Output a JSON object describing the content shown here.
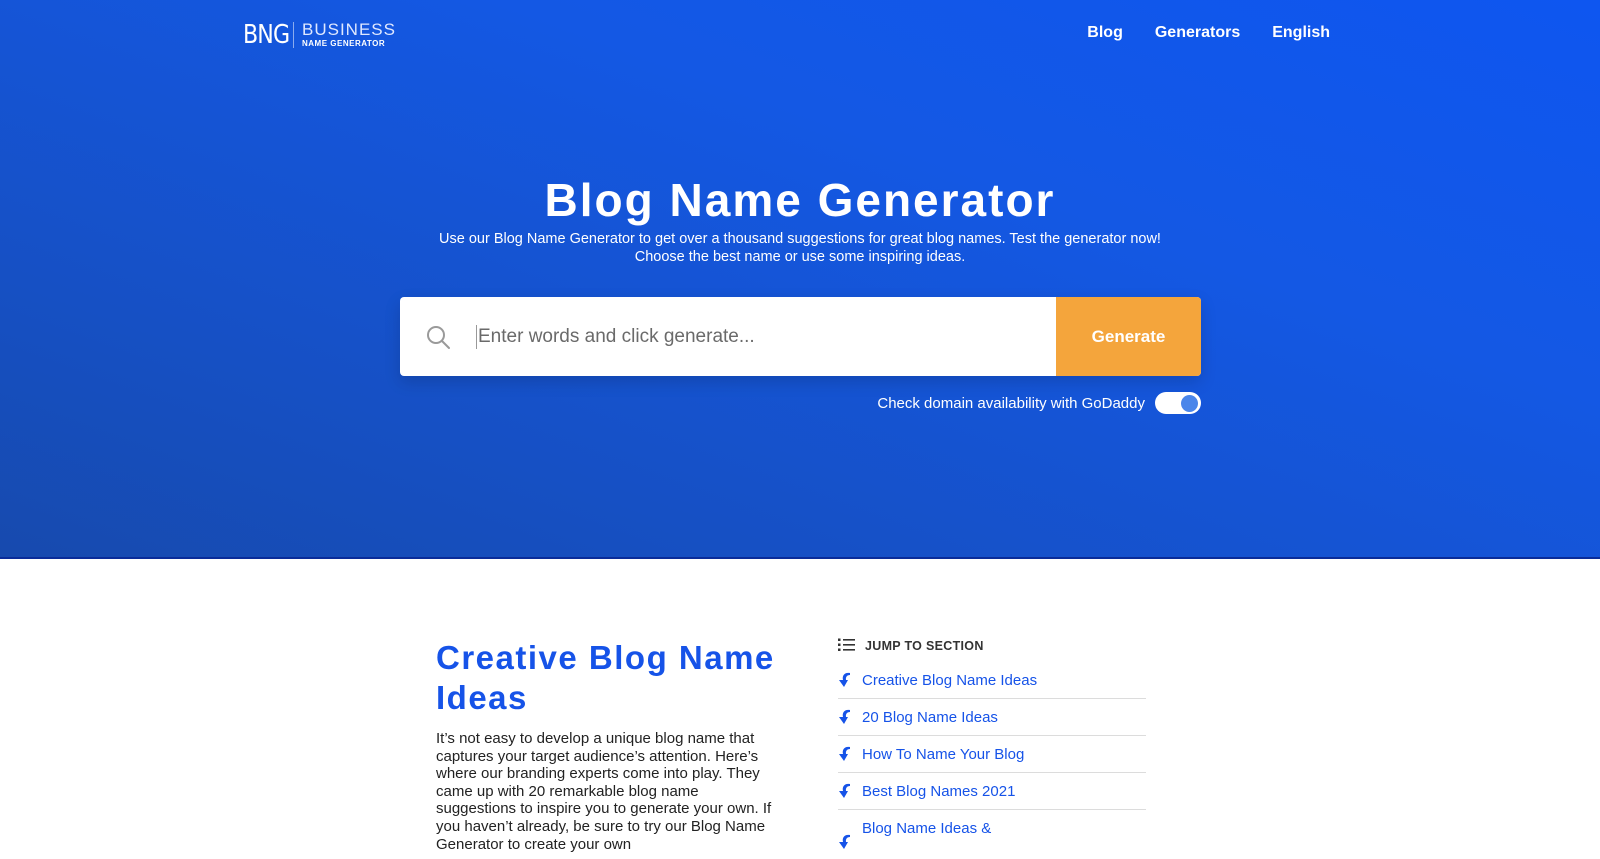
{
  "header": {
    "logo_mark": "BNG",
    "logo_top": "BUSINESS",
    "logo_bottom": "NAME GENERATOR",
    "nav": [
      {
        "label": "Blog"
      },
      {
        "label": "Generators"
      },
      {
        "label": "English"
      }
    ]
  },
  "hero": {
    "title": "Blog Name Generator",
    "subtitle_line1": "Use our Blog Name Generator to get over a thousand suggestions for great blog names. Test the generator now!",
    "subtitle_line2": "Choose the best name or use some inspiring ideas.",
    "search": {
      "icon": "search-icon",
      "value": "",
      "placeholder": "Enter words and click generate..."
    },
    "generate_label": "Generate",
    "domain_check": {
      "label": "Check domain availability with GoDaddy",
      "enabled": true
    }
  },
  "content": {
    "title": "Creative Blog Name Ideas",
    "body": "It’s not easy to develop a unique blog name that captures your target audience’s attention. Here’s where our branding experts come into play. They came up with 20 remarkable blog name suggestions to inspire you to generate your own. If you haven’t already, be sure to try our Blog Name Generator to create your own"
  },
  "toc": {
    "header": "JUMP TO SECTION",
    "icon": "list-icon",
    "items": [
      {
        "label": "Creative Blog Name Ideas",
        "icon": "curved-arrow-down-icon"
      },
      {
        "label": "20 Blog Name Ideas",
        "icon": "curved-arrow-down-icon"
      },
      {
        "label": "How To Name Your Blog",
        "icon": "curved-arrow-down-icon"
      },
      {
        "label": "Best Blog Names 2021",
        "icon": "curved-arrow-down-icon"
      },
      {
        "label": "Blog Name Ideas &",
        "icon": "curved-arrow-down-icon"
      }
    ]
  },
  "colors": {
    "hero_blue": "#1458e4",
    "accent_orange": "#f4a53c",
    "link_blue": "#1653e8",
    "toggle_knob": "#4a86ea"
  }
}
